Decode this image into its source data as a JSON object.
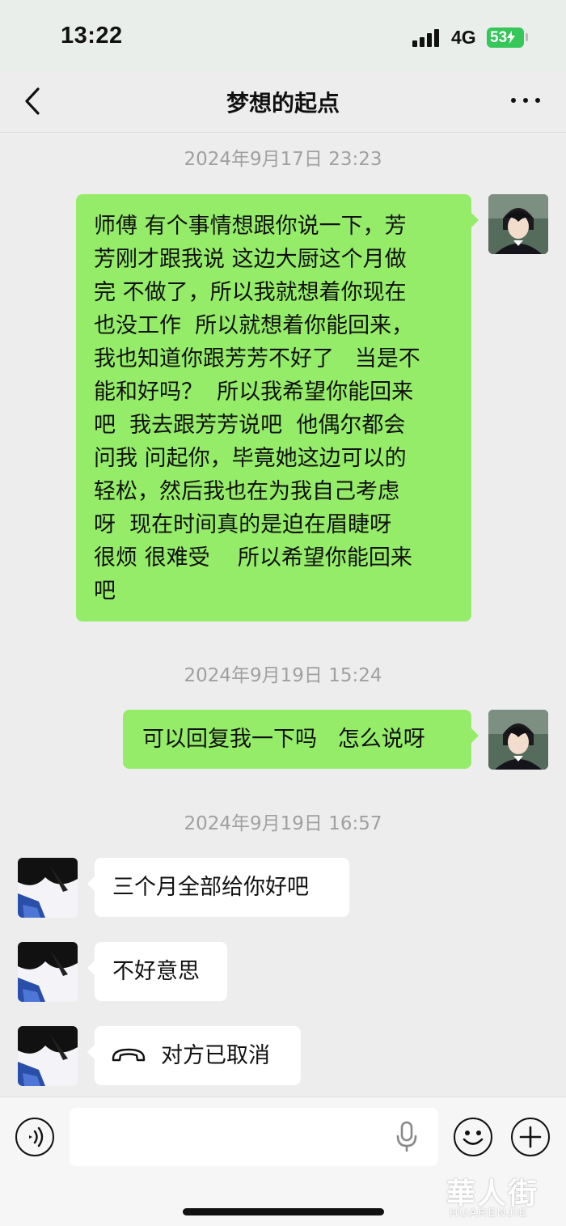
{
  "status_bar": {
    "time": "13:22",
    "network": "4G",
    "battery": "53"
  },
  "nav": {
    "title": "梦想的起点"
  },
  "messages": [
    {
      "type": "timestamp",
      "text": "2024年9月17日 23:23"
    },
    {
      "type": "outgoing",
      "text": "师傅 有个事情想跟你说一下，芳\n芳刚才跟我说 这边大厨这个月做\n完 不做了，所以我就想着你现在\n也没工作  所以就想着你能回来，\n我也知道你跟芳芳不好了   当是不\n能和好吗？  所以我希望你能回来\n吧  我去跟芳芳说吧  他偶尔都会\n问我 问起你，毕竟她这边可以的\n轻松，然后我也在为我自己考虑\n呀  现在时间真的是迫在眉睫呀\n很烦 很难受    所以希望你能回来\n吧"
    },
    {
      "type": "timestamp",
      "text": "2024年9月19日 15:24"
    },
    {
      "type": "outgoing",
      "text": "可以回复我一下吗   怎么说呀"
    },
    {
      "type": "timestamp",
      "text": "2024年9月19日 16:57"
    },
    {
      "type": "incoming",
      "text": "三个月全部给你好吧"
    },
    {
      "type": "incoming",
      "text": "不好意思"
    },
    {
      "type": "incoming_call",
      "text": "对方已取消"
    }
  ],
  "watermark": {
    "main": "華人街",
    "sub": "HUARENJIE"
  },
  "colors": {
    "outgoing_bubble": "#95ec69",
    "incoming_bubble": "#ffffff",
    "background": "#ededed",
    "battery": "#35c759"
  },
  "icons": [
    "back-icon",
    "more-icon",
    "voice-icon",
    "mic-icon",
    "emoji-icon",
    "plus-icon",
    "phone-hangup-icon"
  ]
}
